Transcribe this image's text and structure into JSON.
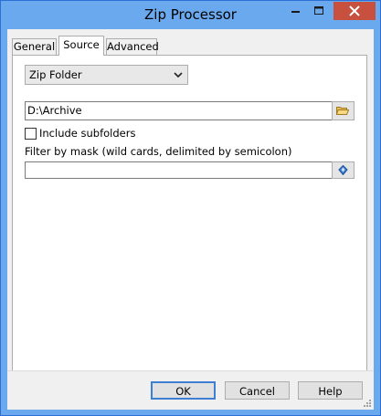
{
  "window": {
    "title": "Zip Processor",
    "controls": {
      "minimize_icon": "minimize-icon",
      "maximize_icon": "maximize-icon",
      "close_icon": "close-icon"
    },
    "colors": {
      "title_bar": "#6aa9ee",
      "close_button": "#c7503f",
      "default_button_border": "#3c7fd3"
    }
  },
  "tabs": [
    {
      "label": "General",
      "active": false
    },
    {
      "label": "Source",
      "active": true
    },
    {
      "label": "Advanced",
      "active": false
    }
  ],
  "source": {
    "type_select": {
      "value": "Zip Folder"
    },
    "path": {
      "value": "D:\\Archive",
      "browse_icon": "folder-open-icon"
    },
    "include_subfolders": {
      "label": "Include subfolders",
      "checked": false
    },
    "mask": {
      "label": "Filter by mask (wild cards, delimited by semicolon)",
      "value": "",
      "placeholder": "",
      "button_icon": "mask-editor-icon"
    }
  },
  "buttons": {
    "ok": "OK",
    "cancel": "Cancel",
    "help": "Help"
  }
}
